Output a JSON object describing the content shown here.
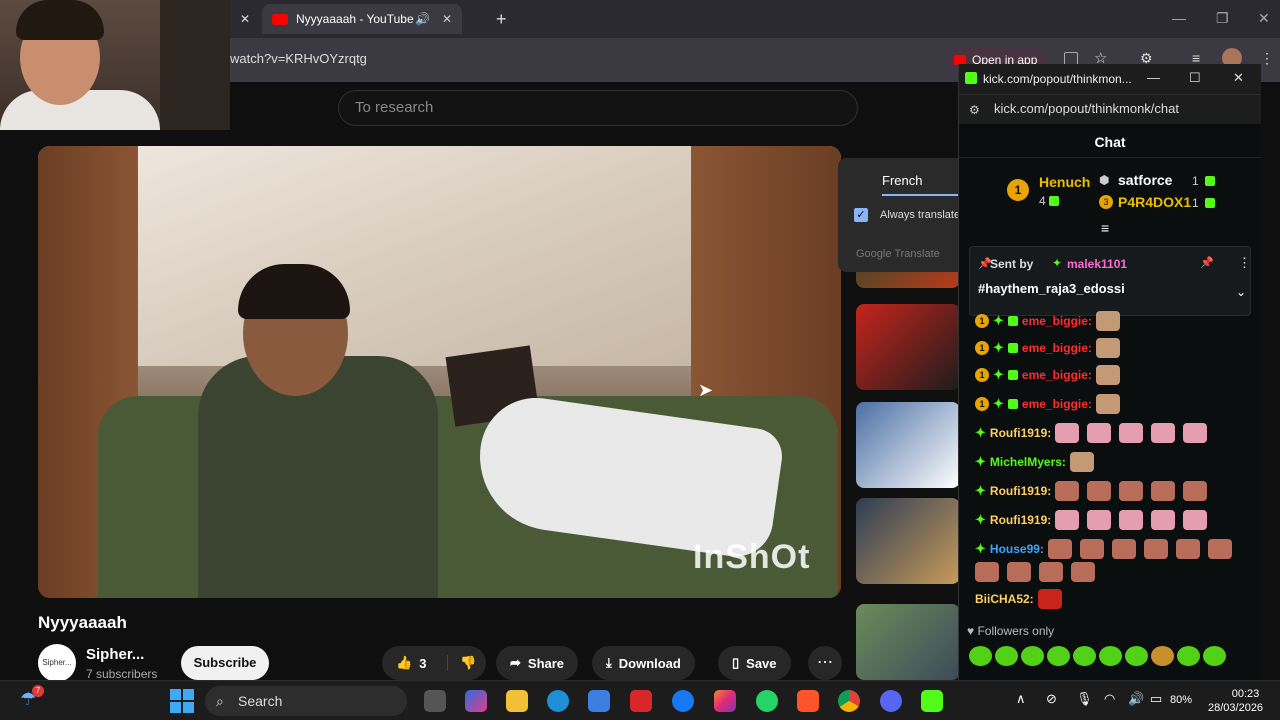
{
  "browser": {
    "tab_title": "Nyyyaaaah - YouTube",
    "url": "watch?v=KRHvOYzrqtg",
    "open_in_app": "Open in app"
  },
  "youtube": {
    "search_placeholder": "To research",
    "video_watermark": "InShOt",
    "video_title": "Nyyyaaaah",
    "channel_avatar": "Sipher...",
    "channel_name": "Sipher...",
    "channel_subs": "7 subscribers",
    "subscribe": "Subscribe",
    "like_count": "3",
    "share": "Share",
    "download": "Download",
    "save": "Save"
  },
  "translate": {
    "language": "French",
    "always_translate": "Always translate",
    "brand": "Google Translate"
  },
  "kick": {
    "window_title": "kick.com/popout/thinkmon...",
    "url": "kick.com/popout/thinkmonk/chat",
    "chat_header": "Chat",
    "leaderboard": [
      {
        "rank": "1",
        "name": "Henuch",
        "count": "4"
      },
      {
        "rank": "",
        "name": "satforce",
        "count": "1"
      },
      {
        "rank": "3",
        "name": "P4R4DOX1",
        "count": "1"
      }
    ],
    "pinned": {
      "sent_by_label": "Sent by",
      "user": "malek1101",
      "message": "#haythem_raja3_edossi"
    },
    "messages": [
      {
        "user": "eme_biggie:",
        "color": "#ff2d2d"
      },
      {
        "user": "eme_biggie:",
        "color": "#ff2d2d"
      },
      {
        "user": "eme_biggie:",
        "color": "#ff2d2d"
      },
      {
        "user": "eme_biggie:",
        "color": "#ff2d2d"
      },
      {
        "user": "Roufi1919:",
        "color": "#ffcf5f"
      },
      {
        "user": "MichelMyers:",
        "color": "#53fc18"
      },
      {
        "user": "Roufi1919:",
        "color": "#ffcf5f"
      },
      {
        "user": "Roufi1919:",
        "color": "#ffcf5f"
      },
      {
        "user": "House99:",
        "color": "#3da5ff"
      },
      {
        "user": "BiiCHA52:",
        "color": "#ffcf5f"
      }
    ],
    "followers_only": "Followers only"
  },
  "taskbar": {
    "search": "Search",
    "battery": "80%",
    "time": "00:23",
    "date": "28/03/2026",
    "notif_badge": "7"
  }
}
